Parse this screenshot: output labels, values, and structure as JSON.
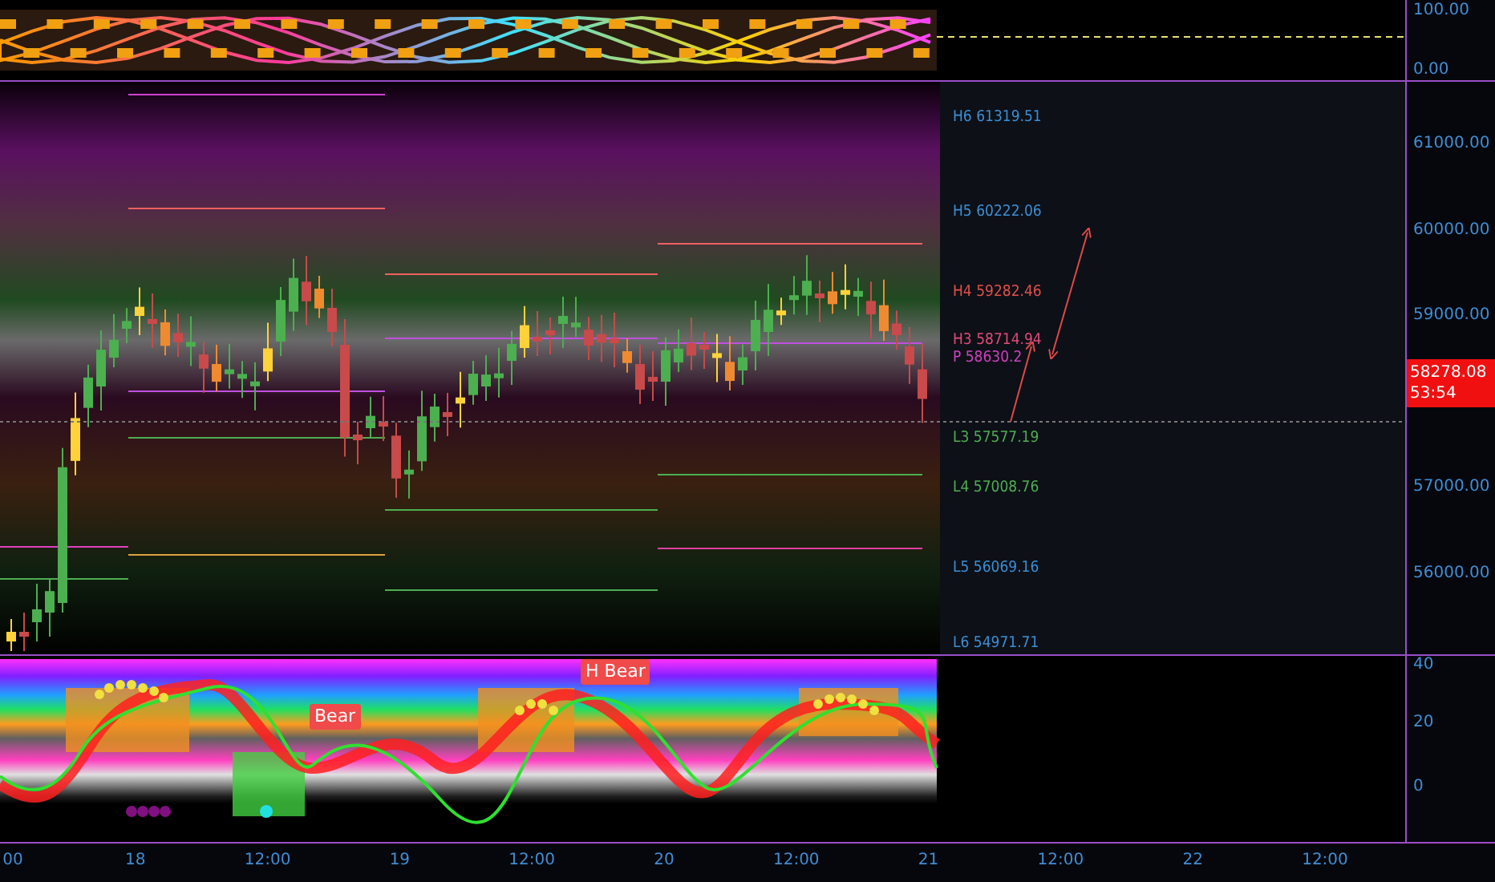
{
  "top_pane": {
    "axis": [
      "100.00",
      "0.00"
    ]
  },
  "main_pane": {
    "levels": [
      {
        "label": "H6 61319.51",
        "color": "#3b8fd6"
      },
      {
        "label": "H5 60222.06",
        "color": "#3b8fd6"
      },
      {
        "label": "H4 59282.46",
        "color": "#e0504a"
      },
      {
        "label": "H3 58714.94",
        "color": "#e04a78"
      },
      {
        "label": "P 58630.2",
        "color": "#d040c0"
      },
      {
        "label": "L3 57577.19",
        "color": "#4caf50"
      },
      {
        "label": "L4 57008.76",
        "color": "#4caf50"
      },
      {
        "label": "L5 56069.16",
        "color": "#3b8fd6"
      },
      {
        "label": "L6 54971.71",
        "color": "#3b8fd6"
      }
    ],
    "axis": [
      "61000.00",
      "60000.00",
      "59000.00",
      "57000.00",
      "56000.00"
    ],
    "price_badge": {
      "price": "58278.08",
      "countdown": "53:54"
    }
  },
  "bottom_pane": {
    "signals": [
      {
        "label": "Bear"
      },
      {
        "label": "H Bear"
      }
    ],
    "axis": [
      "40",
      "20",
      "0"
    ]
  },
  "time_axis": [
    "00",
    "18",
    "12:00",
    "19",
    "12:00",
    "20",
    "12:00",
    "21",
    "12:00",
    "22",
    "12:00"
  ]
}
